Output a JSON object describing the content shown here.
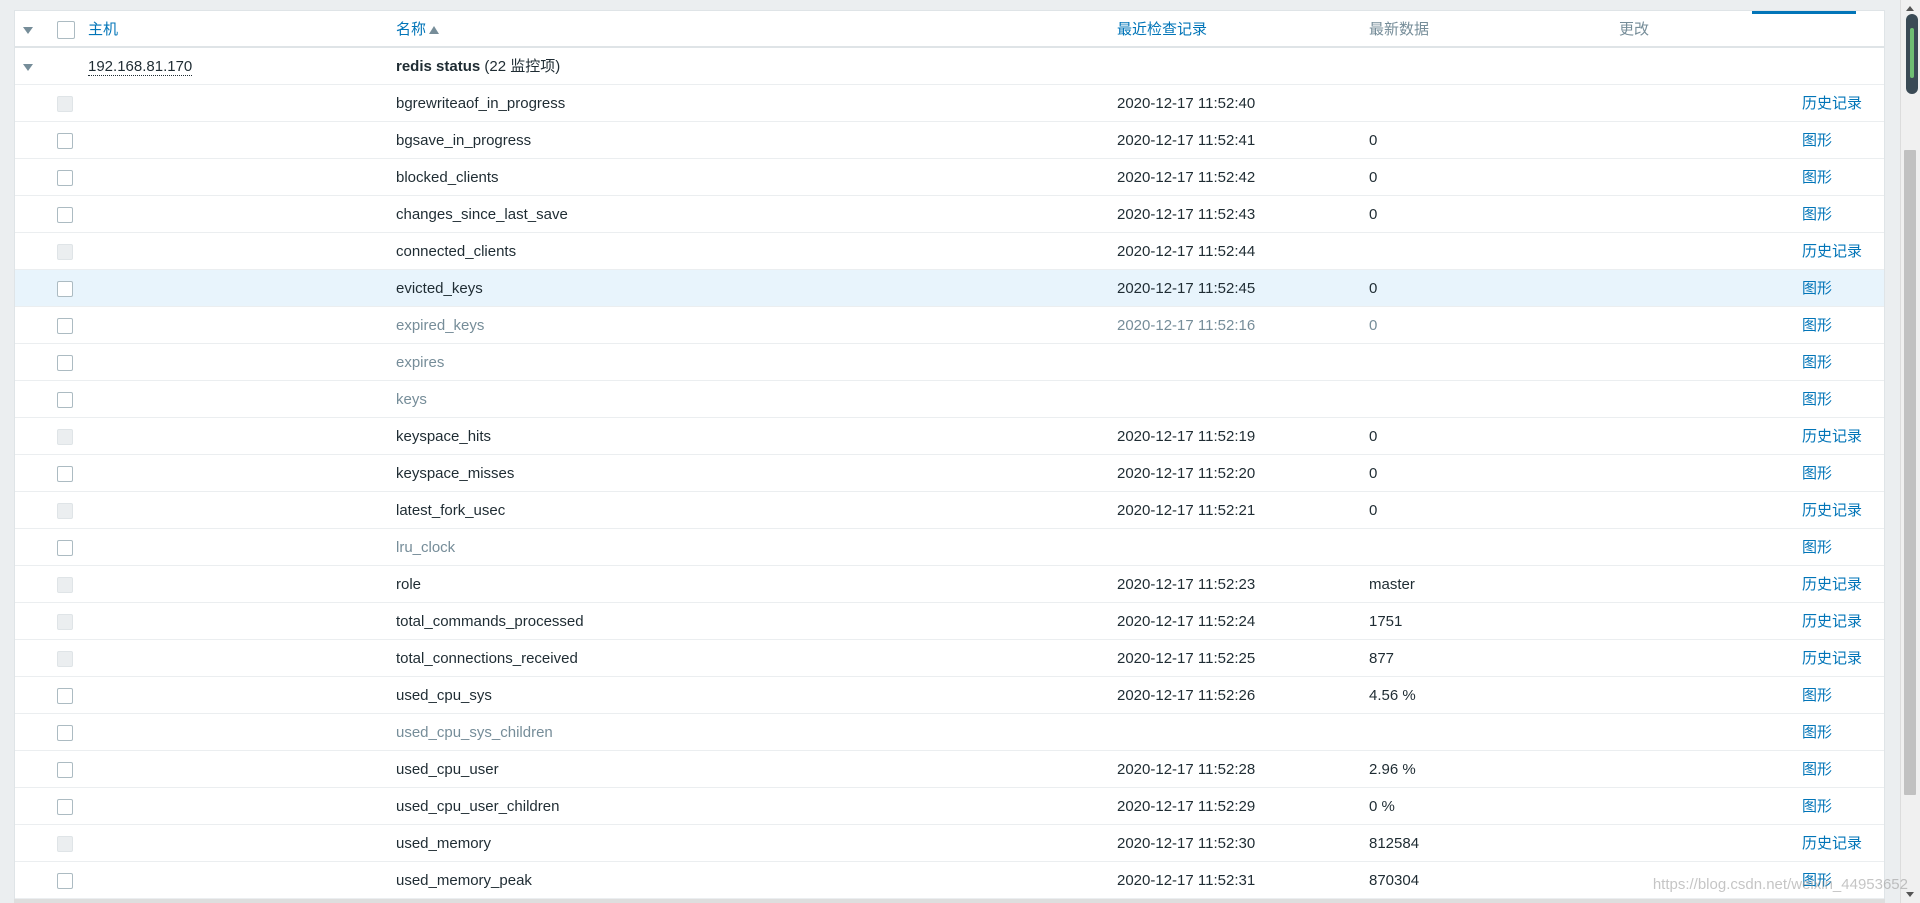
{
  "header": {
    "host": "主机",
    "name": "名称",
    "last_check": "最近检查记录",
    "last_value": "最新数据",
    "change": "更改"
  },
  "group": {
    "host": "192.168.81.170",
    "app_name": "redis status",
    "count": " (22 监控项)"
  },
  "rows": [
    {
      "name": "bgrewriteaof_in_progress",
      "time": "2020-12-17 11:52:40",
      "value": "",
      "link": "历史记录"
    },
    {
      "name": "bgsave_in_progress",
      "time": "2020-12-17 11:52:41",
      "value": "0",
      "link": "图形"
    },
    {
      "name": "blocked_clients",
      "time": "2020-12-17 11:52:42",
      "value": "0",
      "link": "图形"
    },
    {
      "name": "changes_since_last_save",
      "time": "2020-12-17 11:52:43",
      "value": "0",
      "link": "图形"
    },
    {
      "name": "connected_clients",
      "time": "2020-12-17 11:52:44",
      "value": "",
      "link": "历史记录"
    },
    {
      "name": "evicted_keys",
      "time": "2020-12-17 11:52:45",
      "value": "0",
      "link": "图形"
    },
    {
      "name": "expired_keys",
      "time": "2020-12-17 11:52:16",
      "value": "0",
      "link": "图形"
    },
    {
      "name": "expires",
      "time": "",
      "value": "",
      "link": "图形"
    },
    {
      "name": "keys",
      "time": "",
      "value": "",
      "link": "图形"
    },
    {
      "name": "keyspace_hits",
      "time": "2020-12-17 11:52:19",
      "value": "0",
      "link": "历史记录"
    },
    {
      "name": "keyspace_misses",
      "time": "2020-12-17 11:52:20",
      "value": "0",
      "link": "图形"
    },
    {
      "name": "latest_fork_usec",
      "time": "2020-12-17 11:52:21",
      "value": "0",
      "link": "历史记录"
    },
    {
      "name": "lru_clock",
      "time": "",
      "value": "",
      "link": "图形"
    },
    {
      "name": "role",
      "time": "2020-12-17 11:52:23",
      "value": "master",
      "link": "历史记录"
    },
    {
      "name": "total_commands_processed",
      "time": "2020-12-17 11:52:24",
      "value": "1751",
      "link": "历史记录"
    },
    {
      "name": "total_connections_received",
      "time": "2020-12-17 11:52:25",
      "value": "877",
      "link": "历史记录"
    },
    {
      "name": "used_cpu_sys",
      "time": "2020-12-17 11:52:26",
      "value": "4.56 %",
      "link": "图形"
    },
    {
      "name": "used_cpu_sys_children",
      "time": "",
      "value": "",
      "link": "图形"
    },
    {
      "name": "used_cpu_user",
      "time": "2020-12-17 11:52:28",
      "value": "2.96 %",
      "link": "图形"
    },
    {
      "name": "used_cpu_user_children",
      "time": "2020-12-17 11:52:29",
      "value": "0 %",
      "link": "图形"
    },
    {
      "name": "used_memory",
      "time": "2020-12-17 11:52:30",
      "value": "812584",
      "link": "历史记录"
    },
    {
      "name": "used_memory_peak",
      "time": "2020-12-17 11:52:31",
      "value": "870304",
      "link": "图形"
    }
  ],
  "watermark": "https://blog.csdn.net/weixin_44953652"
}
